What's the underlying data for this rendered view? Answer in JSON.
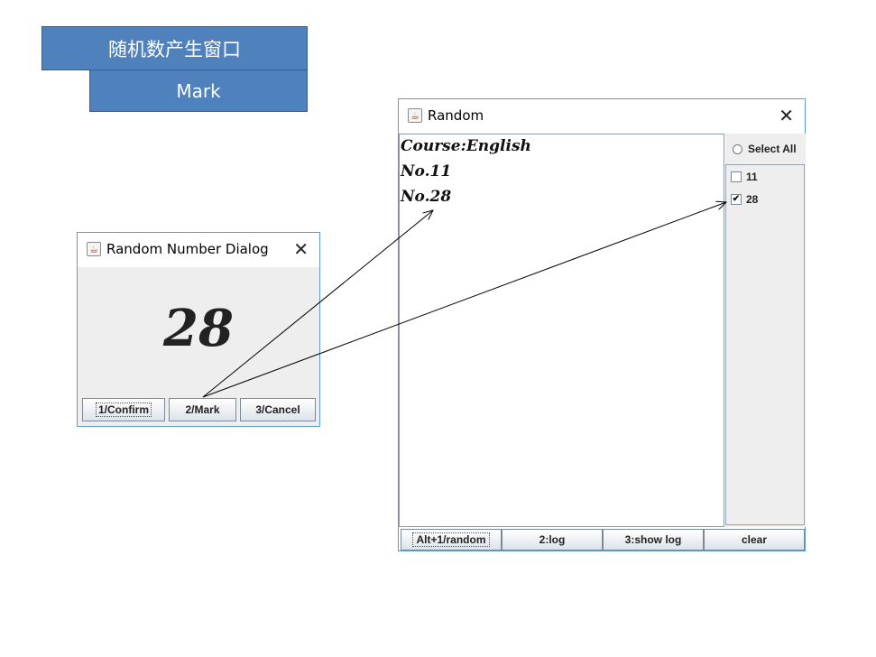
{
  "labels": {
    "top": "随机数产生窗口",
    "mark": "Mark"
  },
  "dialog": {
    "title": "Random Number Dialog",
    "close_glyph": "✕",
    "number": "28",
    "buttons": {
      "confirm": "1/Confirm",
      "mark": "2/Mark",
      "cancel": "3/Cancel"
    }
  },
  "random_window": {
    "title": "Random",
    "close_glyph": "✕",
    "text_lines": [
      "Course:English",
      "No.11",
      "No.28"
    ],
    "select_all_label": "Select All",
    "check_items": [
      {
        "label": "11",
        "checked": false
      },
      {
        "label": "28",
        "checked": true
      }
    ],
    "buttons": {
      "random": "Alt+1/random",
      "log": "2:log",
      "show_log": "3:show log",
      "clear": "clear"
    }
  },
  "icons": {
    "window_icon": "java-cup-icon",
    "check_mark": "✔"
  },
  "colors": {
    "label_fill": "#4f81bd",
    "window_border": "#5b9bd5"
  }
}
